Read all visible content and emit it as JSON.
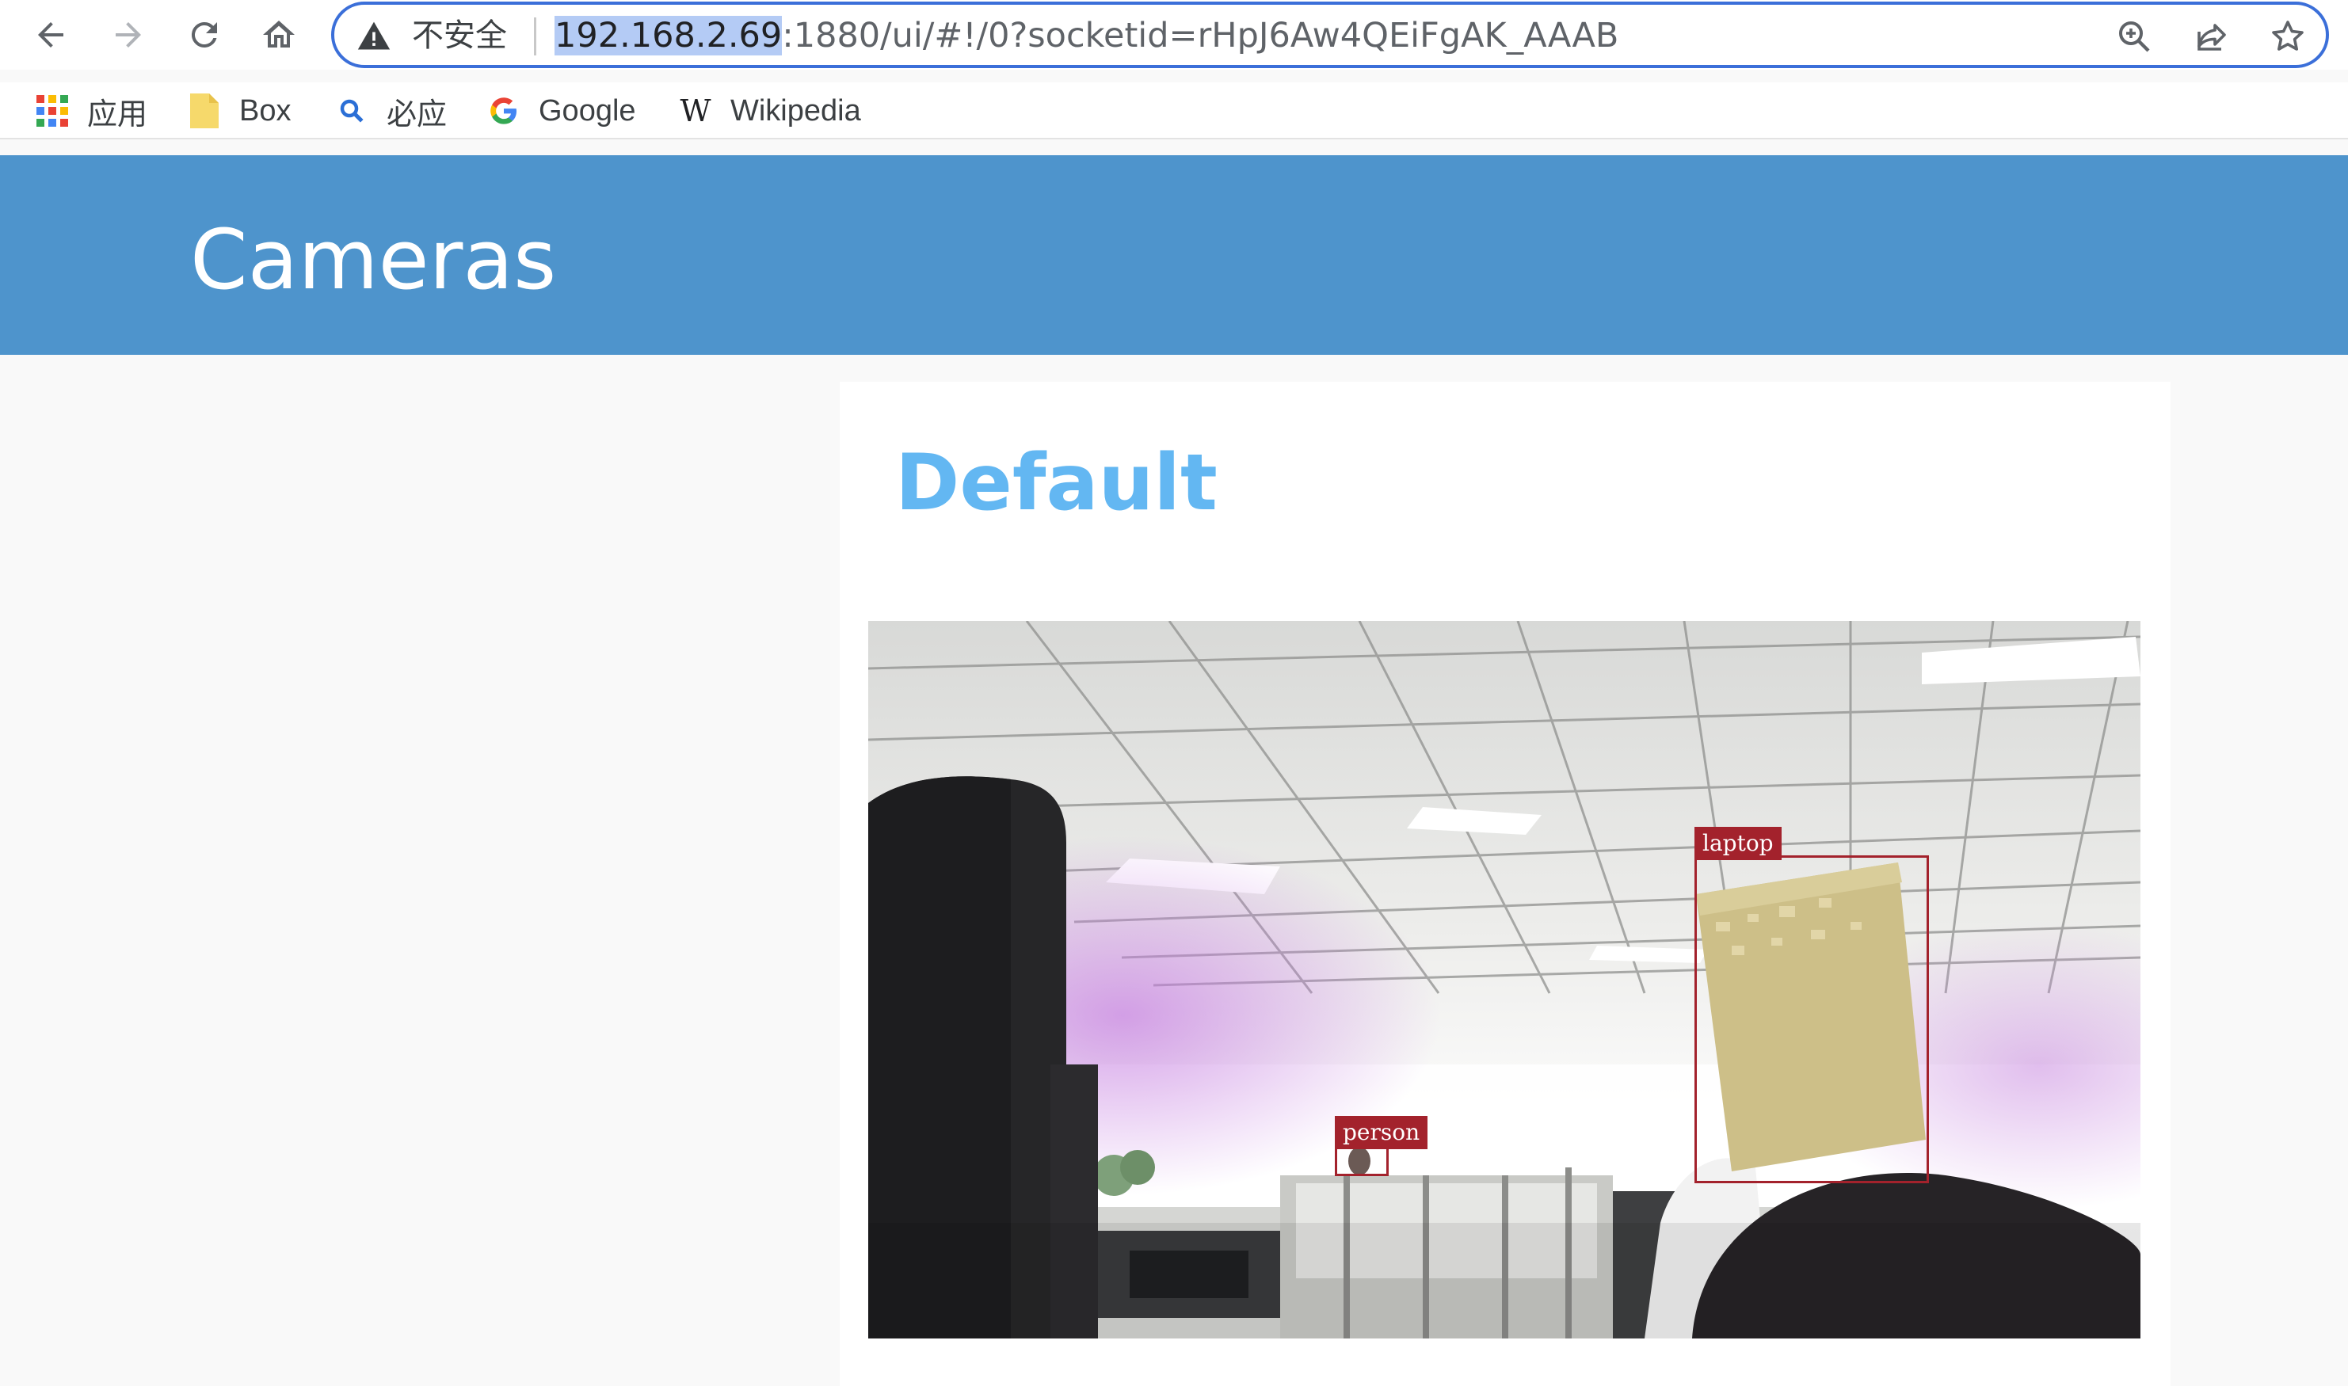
{
  "browser": {
    "security_label": "不安全",
    "url_host": "192.168.2.69",
    "url_rest": ":1880/ui/#!/0?socketid=rHpJ6Aw4QEiFgAK_AAAB",
    "bookmarks": [
      {
        "label": "应用",
        "icon": "apps-grid-icon"
      },
      {
        "label": "Box",
        "icon": "folder-icon"
      },
      {
        "label": "必应",
        "icon": "bing-search-icon"
      },
      {
        "label": "Google",
        "icon": "google-icon"
      },
      {
        "label": "Wikipedia",
        "icon": "wikipedia-icon"
      }
    ]
  },
  "header": {
    "title": "Cameras"
  },
  "card": {
    "title": "Default"
  },
  "detections": [
    {
      "label": "laptop",
      "color": "#a3222c"
    },
    {
      "label": "person",
      "color": "#a3222c"
    }
  ],
  "colors": {
    "header_bg": "#4e94cc",
    "card_title": "#63b7f2",
    "detection": "#a3222c",
    "omnibox_border": "#3b6fd9"
  }
}
